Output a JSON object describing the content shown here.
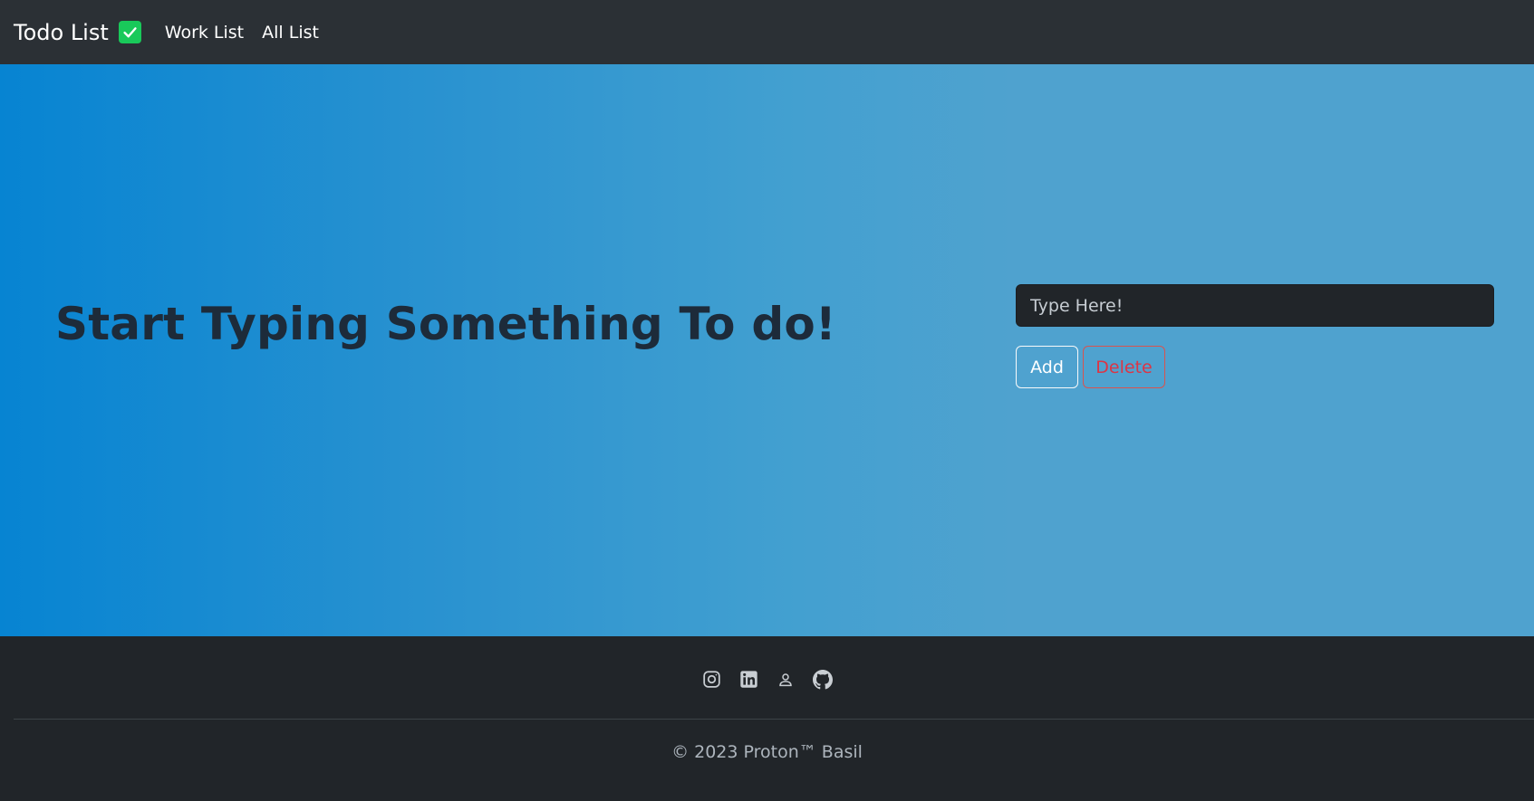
{
  "navbar": {
    "brand": "Todo List",
    "brand_icon": "check-square-icon",
    "brand_icon_color": "#19c95a",
    "links": [
      "Work List",
      "All List"
    ]
  },
  "hero": {
    "title": "Start Typing Something To do!",
    "input_placeholder": "Type Here!",
    "add_label": "Add",
    "delete_label": "Delete"
  },
  "footer": {
    "social_icons": [
      "instagram-icon",
      "linkedin-icon",
      "person-icon",
      "github-icon"
    ],
    "copyright": "© 2023 Proton™ Basil"
  },
  "colors": {
    "navbar": "#2b3035",
    "footer": "#212529",
    "hero_gradient_start": "#0784d2",
    "hero_gradient_end": "#4fa2cf",
    "delete": "#dc3545"
  }
}
